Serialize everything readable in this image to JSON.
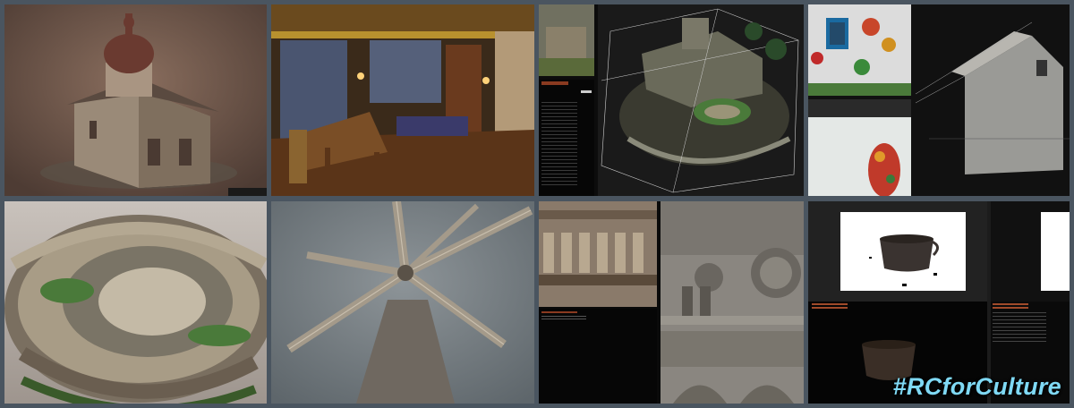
{
  "hashtag": "#RCforCulture",
  "tiles": [
    {
      "subject": "church-model"
    },
    {
      "subject": "palace-interior"
    },
    {
      "subject": "castle-point-cloud"
    },
    {
      "subject": "painted-house"
    },
    {
      "subject": "amphitheater-model"
    },
    {
      "subject": "windmill-model"
    },
    {
      "subject": "cathedral-facade"
    },
    {
      "subject": "pot-scan"
    }
  ],
  "colors": {
    "background": "#4a5560",
    "hashtag": "#7fd9f5",
    "panel": "#060606"
  }
}
